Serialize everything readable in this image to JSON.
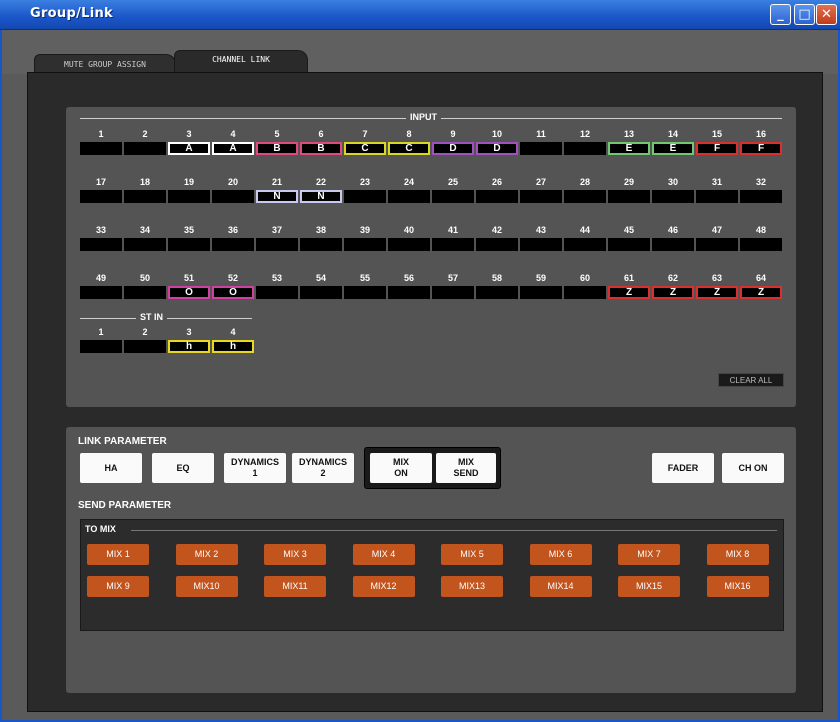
{
  "window": {
    "title": "Group/Link",
    "minimize": "_",
    "maximize": "□",
    "close": "✕"
  },
  "tabs": [
    {
      "label": "MUTE GROUP ASSIGN",
      "active": false
    },
    {
      "label": "CHANNEL LINK",
      "active": true
    }
  ],
  "input_section": {
    "title": "INPUT",
    "rows": [
      {
        "numbers": [
          "1",
          "2",
          "3",
          "4",
          "5",
          "6",
          "7",
          "8",
          "9",
          "10",
          "11",
          "12",
          "13",
          "14",
          "15",
          "16"
        ],
        "links": [
          "",
          "",
          "A",
          "A",
          "B",
          "B",
          "C",
          "C",
          "D",
          "D",
          "",
          "",
          "E",
          "E",
          "F",
          "F"
        ]
      },
      {
        "numbers": [
          "17",
          "18",
          "19",
          "20",
          "21",
          "22",
          "23",
          "24",
          "25",
          "26",
          "27",
          "28",
          "29",
          "30",
          "31",
          "32"
        ],
        "links": [
          "",
          "",
          "",
          "",
          "N",
          "N",
          "",
          "",
          "",
          "",
          "",
          "",
          "",
          "",
          "",
          ""
        ]
      },
      {
        "numbers": [
          "33",
          "34",
          "35",
          "36",
          "37",
          "38",
          "39",
          "40",
          "41",
          "42",
          "43",
          "44",
          "45",
          "46",
          "47",
          "48"
        ],
        "links": [
          "",
          "",
          "",
          "",
          "",
          "",
          "",
          "",
          "",
          "",
          "",
          "",
          "",
          "",
          "",
          ""
        ]
      },
      {
        "numbers": [
          "49",
          "50",
          "51",
          "52",
          "53",
          "54",
          "55",
          "56",
          "57",
          "58",
          "59",
          "60",
          "61",
          "62",
          "63",
          "64"
        ],
        "links": [
          "",
          "",
          "O",
          "O",
          "",
          "",
          "",
          "",
          "",
          "",
          "",
          "",
          "Z",
          "Z",
          "Z",
          "Z"
        ]
      }
    ],
    "link_colors": {
      "A": "#ffffff",
      "B": "#e04880",
      "C": "#d8d820",
      "D": "#a050c0",
      "E": "#70c870",
      "F": "#d83030",
      "N": "#c8c8f0",
      "O": "#d040a0",
      "Z": "#d83030",
      "h": "#e8d820"
    }
  },
  "st_in_section": {
    "title": "ST IN",
    "numbers": [
      "1",
      "2",
      "3",
      "4"
    ],
    "links": [
      "",
      "",
      "h",
      "h"
    ]
  },
  "clear_all": "CLEAR ALL",
  "link_parameter": {
    "title": "LINK PARAMETER",
    "buttons": [
      "HA",
      "EQ",
      "DYNAMICS\n1",
      "DYNAMICS\n2",
      "MIX\nON",
      "MIX\nSEND",
      "FADER",
      "CH ON"
    ]
  },
  "send_parameter": {
    "title": "SEND PARAMETER",
    "to_mix_label": "TO MIX",
    "mix_buttons": [
      "MIX 1",
      "MIX 2",
      "MIX 3",
      "MIX 4",
      "MIX 5",
      "MIX 6",
      "MIX 7",
      "MIX 8",
      "MIX 9",
      "MIX10",
      "MIX11",
      "MIX12",
      "MIX13",
      "MIX14",
      "MIX15",
      "MIX16"
    ]
  },
  "colors": {
    "mix_button": "#c2541e",
    "title_bar": "#1a56c8"
  }
}
